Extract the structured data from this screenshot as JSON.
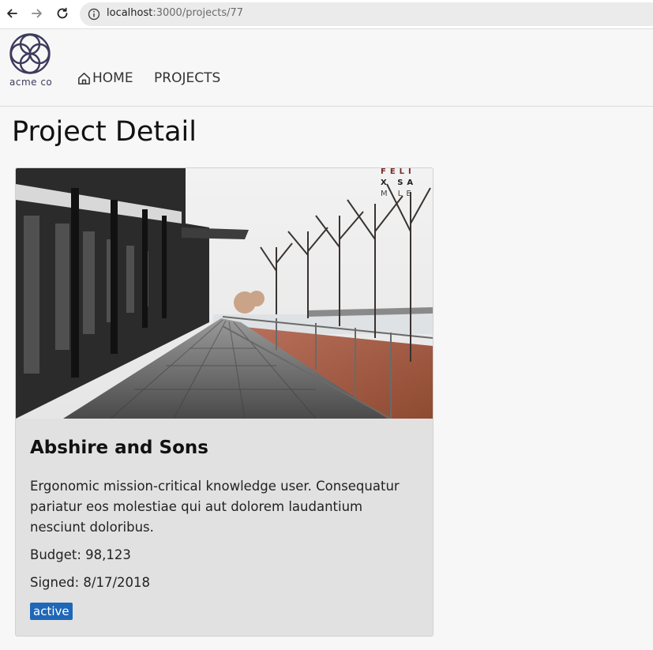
{
  "browser": {
    "url_host": "localhost",
    "url_path": ":3000/projects/77"
  },
  "header": {
    "logo_text": "acme co",
    "nav": {
      "home_label": "HOME",
      "projects_label": "PROJECTS"
    }
  },
  "page": {
    "title": "Project Detail"
  },
  "project": {
    "name": "Abshire and Sons",
    "description": "Ergonomic mission-critical knowledge user. Consequatur pariatur eos molestiae qui aut dolorem laudantium nesciunt doloribus.",
    "budget": "Budget: 98,123",
    "signed": "Signed: 8/17/2018",
    "status": "active",
    "image_watermark": [
      "FELI",
      "X SA",
      "M LE"
    ]
  },
  "colors": {
    "accent": "#1f67b7",
    "logo": "#3d3a5c",
    "card_background": "#e1e1e1"
  },
  "icons": {
    "back": "arrow-left-icon",
    "forward": "arrow-right-icon",
    "reload": "reload-icon",
    "info": "info-icon",
    "home": "home-icon"
  }
}
